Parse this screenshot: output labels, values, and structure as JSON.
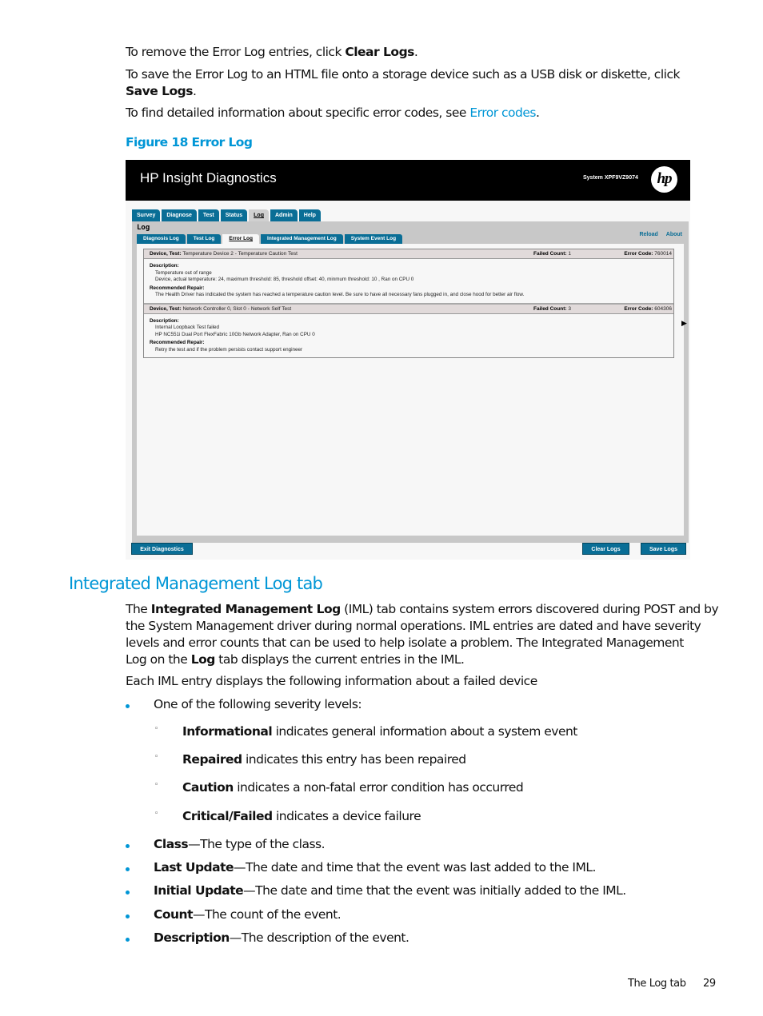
{
  "intro": {
    "p1_prefix": "To remove the Error Log entries, click ",
    "p1_bold": "Clear Logs",
    "p1_suffix": ".",
    "p2_prefix": "To save the Error Log to an HTML file onto a storage device such as a USB disk or diskette, click",
    "p2_bold": "Save Logs",
    "p2_suffix": ".",
    "p3_prefix": "To find detailed information about specific error codes, see ",
    "p3_link": "Error codes",
    "p3_suffix": "."
  },
  "figure": {
    "caption": "Figure 18 Error Log",
    "app_title": "HP Insight Diagnostics",
    "system_label": "System XPF9VZ9074",
    "logo_text": "hp",
    "main_tabs": [
      "Survey",
      "Diagnose",
      "Test",
      "Status",
      "Log",
      "Admin",
      "Help"
    ],
    "active_main_tab": "Log",
    "panel_title": "Log",
    "sub_tabs": [
      "Diagnosis Log",
      "Test Log",
      "Error Log",
      "Integrated Management Log",
      "System Event Log"
    ],
    "active_sub_tab": "Error Log",
    "panel_links": [
      "Reload",
      "About"
    ],
    "entries": [
      {
        "device_label": "Device, Test:",
        "device_value": "Temperature Device 2 - Temperature Caution Test",
        "failed_label": "Failed Count:",
        "failed_value": "1",
        "code_label": "Error Code:",
        "code_value": "760014",
        "description_label": "Description:",
        "description_lines": [
          "Temperature out of range",
          "Device, actual temperature: 24, maximum threshold: 85, threshold offset: 40, minmum threshold: 10 , Ran on CPU 0"
        ],
        "repair_label": "Recommended Repair:",
        "repair_text": "The Health Driver has indicated the system has reached a temperature caution level. Be sure to have all necessary fans plugged in, and close hood for better air flow."
      },
      {
        "device_label": "Device, Test:",
        "device_value": "Network Controller 0, Slot 0 - Network Self Test",
        "failed_label": "Failed Count:",
        "failed_value": "3",
        "code_label": "Error Code:",
        "code_value": "604306",
        "description_label": "Description:",
        "description_lines": [
          "Internal Loopback Test failed",
          "HP NC551i Dual Port FlexFabric 10Gb Network Adapter, Ran on CPU 0"
        ],
        "repair_label": "Recommended Repair:",
        "repair_text": "Retry the test and if the problem persists contact support engineer"
      }
    ],
    "buttons": {
      "exit": "Exit Diagnostics",
      "clear": "Clear Logs",
      "save": "Save Logs"
    }
  },
  "section": {
    "heading": "Integrated Management Log tab",
    "p1_prefix": "The ",
    "p1_bold1": "Integrated Management Log",
    "p1_mid1": " (IML) tab contains system errors discovered during POST and by",
    "p1_line2": "the System Management driver during normal operations. IML entries are dated and have severity",
    "p1_line3": "levels and error counts that can be used to help isolate a problem. The Integrated Management",
    "p1_line4_prefix": "Log on the ",
    "p1_bold2": "Log",
    "p1_line4_suffix": " tab displays the current entries in the IML.",
    "p2": "Each IML entry displays the following information about a failed device",
    "severity_intro": "One of the following severity levels:",
    "severity_levels": [
      {
        "term": "Informational",
        "desc": " indicates general information about a system event"
      },
      {
        "term": "Repaired",
        "desc": " indicates this entry has been repaired"
      },
      {
        "term": "Caution",
        "desc": " indicates a non-fatal error condition has occurred"
      },
      {
        "term": "Critical/Failed",
        "desc": " indicates a device failure"
      }
    ],
    "fields": [
      {
        "term": "Class",
        "desc": "—The type of the class."
      },
      {
        "term": "Last Update",
        "desc": "—The date and time that the event was last added to the IML."
      },
      {
        "term": "Initial Update",
        "desc": "—The date and time that the event was initially added to the IML."
      },
      {
        "term": "Count",
        "desc": "—The count of the event."
      },
      {
        "term": "Description",
        "desc": "—The description of the event."
      }
    ]
  },
  "footer": {
    "section_name": "The Log tab",
    "page_number": "29"
  },
  "colors": {
    "accent": "#0096d6",
    "ui_tab": "#0a6e96"
  }
}
